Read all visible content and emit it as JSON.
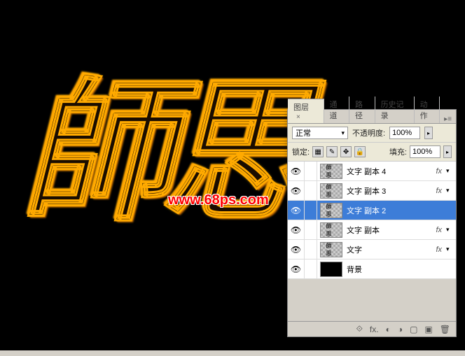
{
  "canvas": {
    "text_effect": "師思",
    "watermark": "www.68ps.com"
  },
  "panel": {
    "tabs": {
      "layers": "图层",
      "channels": "通道",
      "paths": "路径",
      "history": "历史记录",
      "actions": "动作"
    },
    "blend_mode": "正常",
    "opacity_label": "不透明度:",
    "opacity_value": "100%",
    "lock_label": "锁定:",
    "fill_label": "填充:",
    "fill_value": "100%",
    "layers": [
      {
        "name": "文字 副本 4",
        "fx": true,
        "selected": false,
        "thumb": "text"
      },
      {
        "name": "文字 副本 3",
        "fx": true,
        "selected": false,
        "thumb": "text"
      },
      {
        "name": "文字 副本 2",
        "fx": false,
        "selected": true,
        "thumb": "text"
      },
      {
        "name": "文字 副本",
        "fx": true,
        "selected": false,
        "thumb": "text"
      },
      {
        "name": "文字",
        "fx": true,
        "selected": false,
        "thumb": "text"
      },
      {
        "name": "背景",
        "fx": false,
        "selected": false,
        "thumb": "black"
      }
    ],
    "fx_text": "fx"
  }
}
